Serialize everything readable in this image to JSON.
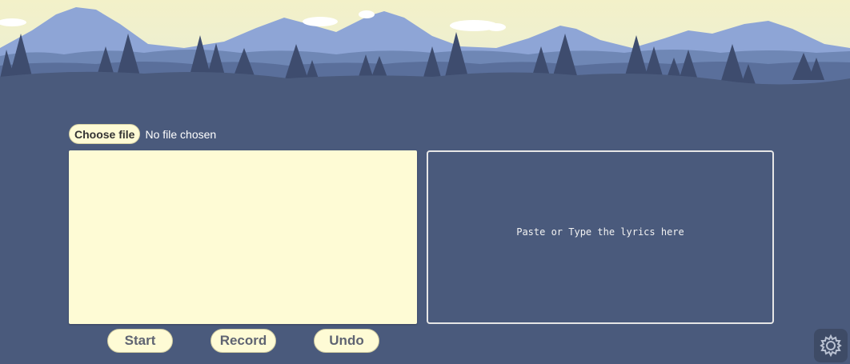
{
  "file_input": {
    "button_label": "Choose file",
    "status_text": "No file chosen"
  },
  "lyrics": {
    "placeholder": "Paste or Type the lyrics here",
    "value": ""
  },
  "controls": {
    "start_label": "Start",
    "record_label": "Record",
    "undo_label": "Undo"
  },
  "icons": {
    "settings": "gear-icon"
  },
  "colors": {
    "background": "#4a5a7c",
    "panel_cream": "#fefbd5",
    "sky": "#f5f2c8",
    "mountains": "#8fa6d6",
    "trees_far": "#6f87b5",
    "trees_near": "#3d4c6d"
  }
}
